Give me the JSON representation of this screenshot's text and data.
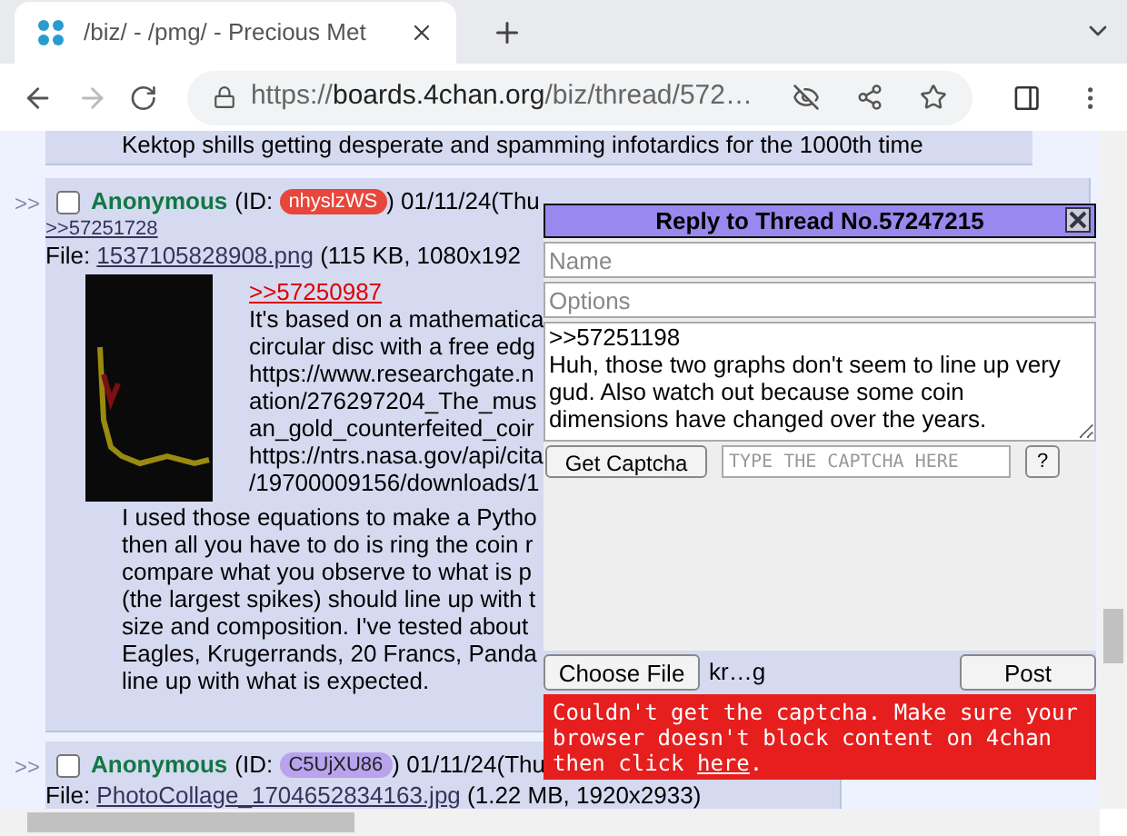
{
  "browser": {
    "tab": {
      "title": "/biz/ - /pmg/ - Precious Met"
    },
    "address": {
      "scheme": "https://",
      "host": "boards.4chan.org",
      "path": "/biz/thread/572…"
    }
  },
  "top_post_fragment": "Kektop shills getting desperate and spamming infotardics for the 1000th time",
  "posts": [
    {
      "arrow": ">>",
      "checked": false,
      "name": "Anonymous",
      "id_prefix": "(ID: ",
      "id_badge": {
        "text": "nhyslzWS",
        "color": "#e8463b"
      },
      "id_suffix": ") 01/11/24(Thu",
      "backlink": ">>57251728",
      "file_label": "File: ",
      "file_name": "1537105828908.png",
      "file_info": " (115 KB, 1080x192",
      "thumbnail": true,
      "quote": ">>57250987",
      "side_lines": [
        "It's based on a mathematica",
        "circular disc with a free edg",
        "https://www.researchgate.n",
        "ation/276297204_The_mus",
        "an_gold_counterfeited_coir",
        "https://ntrs.nasa.gov/api/cita",
        "/19700009156/downloads/1"
      ],
      "lines": [
        "I used those equations to make a Pytho",
        "then all you have to do is ring the coin r",
        "compare what you observe to what is p",
        "(the largest spikes) should line up with t",
        "size and composition. I've tested about",
        "Eagles, Krugerrands, 20 Francs, Panda",
        "line up with what is expected."
      ]
    },
    {
      "arrow": ">>",
      "checked": false,
      "name": "Anonymous",
      "id_prefix": "(ID: ",
      "id_badge": {
        "text": "C5UjXU86",
        "color": "#b9a3ee"
      },
      "id_suffix": ") 01/11/24(Thu",
      "file_label": "File: ",
      "file_name": "PhotoCollage_1704652834163.jpg",
      "file_info": " (1.22 MB, 1920x2933)",
      "thumbnail": false
    }
  ],
  "reply_form": {
    "title": "Reply to Thread No.57247215",
    "name_placeholder": "Name",
    "options_placeholder": "Options",
    "comment": ">>57251198\nHuh, those two graphs don't seem to line up very gud. Also watch out because some coin dimensions have changed over the years.",
    "captcha_button": "Get Captcha",
    "captcha_placeholder": "TYPE THE CAPTCHA HERE",
    "help_button": "?",
    "file_button": "Choose File",
    "file_name": "kr…g",
    "post_button": "Post",
    "error": {
      "before": "Couldn't get the captcha. Make sure your browser doesn't block content on 4chan then click ",
      "link": "here",
      "after": "."
    }
  }
}
